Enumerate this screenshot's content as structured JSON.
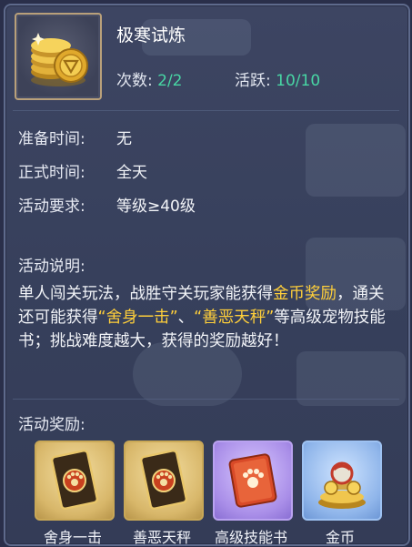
{
  "activity": {
    "title": "极寒试炼",
    "icon": "gold-coins-icon",
    "count_label": "次数:",
    "count_value": "2/2",
    "activity_label": "活跃:",
    "activity_value": "10/10"
  },
  "details": [
    {
      "label": "准备时间:",
      "value": "无"
    },
    {
      "label": "正式时间:",
      "value": "全天"
    },
    {
      "label": "活动要求:",
      "value": "等级≥40级"
    }
  ],
  "description": {
    "label": "活动说明:",
    "text_1": "单人闯关玩法，战胜守关玩家能获得",
    "hl_1": "金币奖励",
    "text_2": "，通关还可能获得",
    "hl_2": "“舍身一击”",
    "text_3": "、",
    "hl_3": "“善恶天秤”",
    "text_4": "等高级宠物技能书；挑战难度越大，获得的奖励越好！"
  },
  "rewards": {
    "label": "活动奖励:",
    "items": [
      {
        "name": "舍身一击",
        "icon": "skill-card-icon"
      },
      {
        "name": "善恶天秤",
        "icon": "skill-card-icon"
      },
      {
        "name": "高级技能书",
        "icon": "skill-book-icon"
      },
      {
        "name": "金币",
        "icon": "gold-coin-pile-icon"
      }
    ]
  },
  "colors": {
    "highlight": "#ffcf3a",
    "value_green": "#48d6a4",
    "panel_bg": "#3b4360"
  }
}
